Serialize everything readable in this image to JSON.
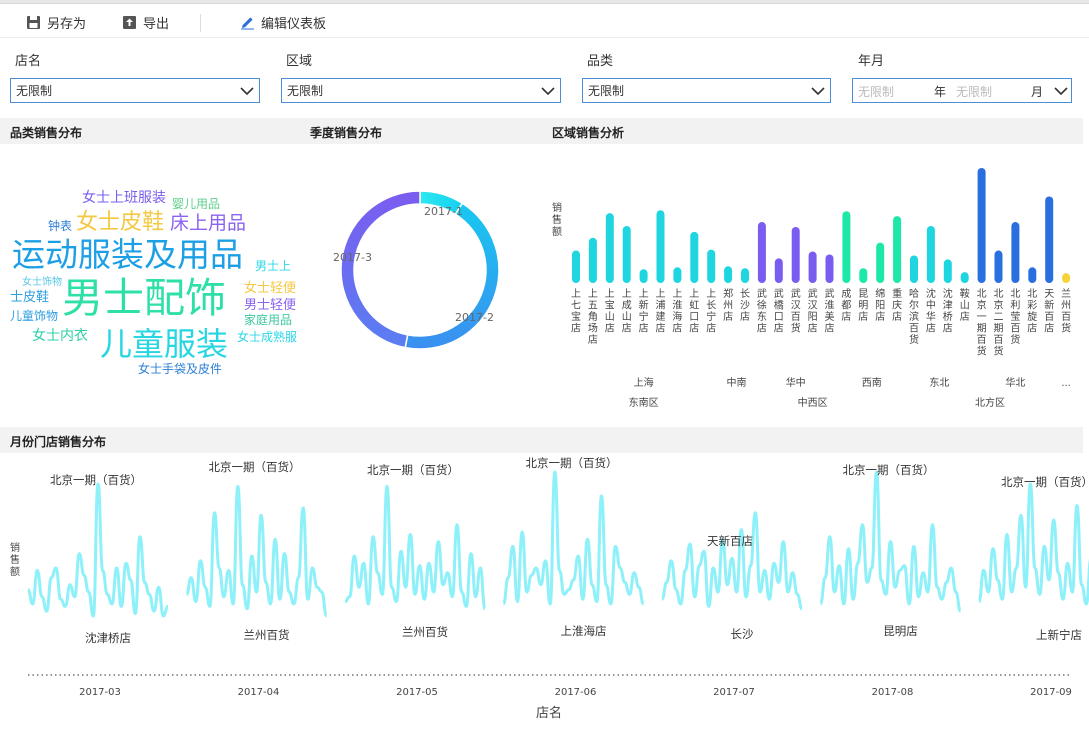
{
  "toolbar": {
    "save_as": "另存为",
    "export": "导出",
    "edit_dashboard": "编辑仪表板"
  },
  "filters": [
    {
      "label": "店名",
      "value": "无限制"
    },
    {
      "label": "区域",
      "value": "无限制"
    },
    {
      "label": "品类",
      "value": "无限制"
    }
  ],
  "year_month": {
    "label": "年月",
    "year_placeholder": "无限制",
    "year_unit": "年",
    "month_placeholder": "无限制",
    "month_unit": "月"
  },
  "sections": {
    "category": "品类销售分布",
    "quarter": "季度销售分布",
    "region": "区域销售分析",
    "monthly": "月份门店销售分布"
  },
  "word_cloud": [
    {
      "text": "女士上班服装",
      "color": "#7b5cf0"
    },
    {
      "text": "婴儿用品",
      "color": "#5cd08a"
    },
    {
      "text": "钟表",
      "color": "#2d7fd8"
    },
    {
      "text": "女士皮鞋",
      "color": "#f5c843"
    },
    {
      "text": "床上用品",
      "color": "#8a63f0"
    },
    {
      "text": "运动服装及用品",
      "color": "#1d9fe6"
    },
    {
      "text": "男士上",
      "color": "#2dd7e8"
    },
    {
      "text": "女士饰物",
      "color": "#58c8e8"
    },
    {
      "text": "男士配饰",
      "color": "#2ee0a8"
    },
    {
      "text": "女士轻便",
      "color": "#f5c843"
    },
    {
      "text": "士皮鞋",
      "color": "#2d9ee0"
    },
    {
      "text": "男士轻便",
      "color": "#8a63f0"
    },
    {
      "text": "儿童饰物",
      "color": "#2d9ee0"
    },
    {
      "text": "家庭用品",
      "color": "#3cc6a0"
    },
    {
      "text": "女士内衣",
      "color": "#2ecfa8"
    },
    {
      "text": "儿童服装",
      "color": "#26d6e0"
    },
    {
      "text": "女士成熟服",
      "color": "#2dd7e8"
    },
    {
      "text": "女士手袋及皮件",
      "color": "#2d7fd8"
    }
  ],
  "colors": {
    "accent": "#4a8fd6",
    "bar_teal": "#1fd6e0",
    "bar_purple": "#7b5cf0",
    "bar_green": "#1ee8a8",
    "bar_blue": "#2a6fe0",
    "bar_yellow": "#f5d33a",
    "line": "#8ef0f8"
  },
  "chart_data": [
    {
      "type": "pie",
      "title": "季度销售分布",
      "categories": [
        "2017-1",
        "2017-2",
        "2017-3"
      ],
      "values": [
        9,
        44,
        47
      ]
    },
    {
      "type": "bar",
      "title": "区域销售分析",
      "ylabel": "销售额",
      "categories": [
        "上七宝店",
        "上五角场店",
        "上宝山店",
        "上成山店",
        "上新宁店",
        "上浦建店",
        "上淮海店",
        "上虹口店",
        "上长宁店",
        "郑州店",
        "长沙店",
        "武徐东店",
        "武橋口店",
        "武汉百货",
        "武汉阳店",
        "武淮美店",
        "成都店",
        "昆明店",
        "绵阳店",
        "重庆店",
        "哈尔滨百货",
        "沈中华店",
        "沈津桥店",
        "鞍山店",
        "北京一期(百货)",
        "北京二期(百货)",
        "北利莹百货",
        "北彩旋店",
        "天新百店",
        "兰州百货"
      ],
      "values": [
        33,
        46,
        71,
        58,
        14,
        74,
        16,
        52,
        34,
        17,
        15,
        62,
        25,
        57,
        32,
        29,
        73,
        15,
        41,
        68,
        28,
        58,
        24,
        11,
        117,
        33,
        62,
        16,
        88,
        10
      ],
      "groups": [
        {
          "name": "上海",
          "parent": "东南区",
          "range": [
            0,
            8
          ]
        },
        {
          "name": "中南",
          "parent": "中西区",
          "range": [
            9,
            10
          ]
        },
        {
          "name": "华中",
          "parent": "中西区",
          "range": [
            11,
            15
          ]
        },
        {
          "name": "西南",
          "parent": "中西区",
          "range": [
            16,
            19
          ]
        },
        {
          "name": "东北",
          "parent": "北方区",
          "range": [
            20,
            23
          ]
        },
        {
          "name": "华北",
          "parent": "北方区",
          "range": [
            24,
            28
          ]
        },
        {
          "name": "...",
          "parent": "北方区",
          "range": [
            29,
            29
          ]
        }
      ],
      "group_parents": [
        "东南区",
        "中西区",
        "北方区"
      ]
    },
    {
      "type": "line",
      "title": "月份门店销售分布",
      "xlabel": "店名",
      "ylabel": "销售额",
      "months": [
        "2017-03",
        "2017-04",
        "2017-05",
        "2017-06",
        "2017-07",
        "2017-08",
        "2017-09"
      ],
      "annotations": [
        {
          "text": "北京一期（百货）",
          "month": 0,
          "kind": "peak"
        },
        {
          "text": "沈津桥店",
          "month": 0,
          "kind": "low"
        },
        {
          "text": "北京一期（百货）",
          "month": 1,
          "kind": "peak"
        },
        {
          "text": "兰州百货",
          "month": 1,
          "kind": "low"
        },
        {
          "text": "北京一期（百货）",
          "month": 2,
          "kind": "peak"
        },
        {
          "text": "兰州百货",
          "month": 2,
          "kind": "low"
        },
        {
          "text": "北京一期（百货）",
          "month": 3,
          "kind": "peak"
        },
        {
          "text": "上淮海店",
          "month": 3,
          "kind": "low"
        },
        {
          "text": "天新百店",
          "month": 4,
          "kind": "peak"
        },
        {
          "text": "长沙",
          "month": 4,
          "kind": "low"
        },
        {
          "text": "北京一期（百货）",
          "month": 5,
          "kind": "peak"
        },
        {
          "text": "昆明店",
          "month": 5,
          "kind": "low"
        },
        {
          "text": "北京一期（百货）",
          "month": 6,
          "kind": "peak"
        },
        {
          "text": "上新宁店",
          "month": 6,
          "kind": "low"
        }
      ],
      "series": [
        {
          "month": "2017-03",
          "values": [
            42,
            30,
            58,
            36,
            24,
            52,
            60,
            34,
            28,
            46,
            36,
            72,
            54,
            40,
            20,
            130,
            58,
            38,
            30,
            60,
            28,
            64,
            50,
            22,
            86,
            48,
            38,
            24,
            44,
            20,
            28
          ]
        },
        {
          "month": "2017-04",
          "values": [
            38,
            52,
            32,
            66,
            44,
            28,
            106,
            60,
            36,
            58,
            30,
            128,
            46,
            26,
            70,
            40,
            104,
            48,
            30,
            84,
            34,
            72,
            40,
            30,
            52,
            110,
            34,
            60,
            44,
            40,
            20
          ]
        },
        {
          "month": "2017-05",
          "values": [
            32,
            36,
            70,
            44,
            64,
            30,
            86,
            56,
            38,
            128,
            44,
            32,
            74,
            44,
            88,
            38,
            62,
            34,
            64,
            40,
            82,
            46,
            56,
            36,
            96,
            40,
            28,
            72,
            36,
            60,
            26
          ]
        },
        {
          "month": "2017-06",
          "values": [
            30,
            52,
            78,
            32,
            90,
            40,
            54,
            60,
            46,
            66,
            30,
            140,
            58,
            38,
            42,
            50,
            70,
            34,
            84,
            46,
            32,
            120,
            46,
            30,
            78,
            60,
            48,
            38,
            56,
            44,
            30
          ]
        },
        {
          "month": "2017-07",
          "values": [
            34,
            48,
            66,
            42,
            30,
            58,
            80,
            36,
            62,
            74,
            28,
            60,
            40,
            84,
            46,
            68,
            40,
            92,
            36,
            62,
            106,
            40,
            58,
            34,
            64,
            48,
            82,
            40,
            56,
            38,
            26
          ]
        },
        {
          "month": "2017-08",
          "values": [
            30,
            52,
            86,
            40,
            62,
            30,
            76,
            34,
            64,
            96,
            48,
            60,
            140,
            50,
            38,
            82,
            44,
            58,
            62,
            30,
            78,
            36,
            56,
            40,
            96,
            44,
            34,
            48,
            60,
            40,
            24
          ]
        },
        {
          "month": "2017-09",
          "values": [
            32,
            58,
            40,
            76,
            50,
            34,
            88,
            40,
            60,
            104,
            44,
            130,
            60,
            38,
            78,
            50,
            100,
            56,
            34,
            64,
            40,
            112,
            46,
            30,
            68,
            44,
            80,
            38,
            52,
            40,
            30
          ]
        }
      ]
    }
  ]
}
